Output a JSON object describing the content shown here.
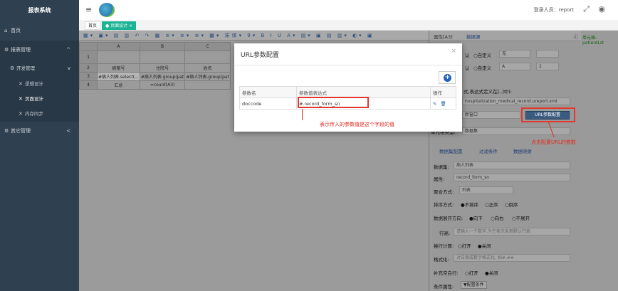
{
  "app": {
    "brand": "报表系统"
  },
  "sidebar": {
    "home": "首页",
    "report_mgmt": "报表管理",
    "dev_mgmt": "开发管理",
    "logic_design": "逻辑设计",
    "page_design": "页面设计",
    "memory_sync": "内存同步",
    "other_mgmt": "其它管理"
  },
  "header": {
    "login_user": "登录人员：report"
  },
  "tabs": {
    "home": "首页",
    "page_design": "● 页面设计 ×"
  },
  "toolbar": {
    "icons": "▦▾ ▣▾ ▤ ▥ ↶ ↷ ▦ ≡▾ ≡▾ ≡▾ ▦▾ 宋体▾ 9▾ B I U A▾ ▤▾ ▣ ▤ ▥▾ ◐▾ ▣"
  },
  "grid": {
    "columns": [
      "A",
      "B",
      "C"
    ],
    "rows": [
      {
        "num": "1",
        "cells": [
          "",
          "",
          ""
        ]
      },
      {
        "num": "2",
        "cells": [
          "病案号",
          "住院号",
          "姓名"
        ]
      },
      {
        "num": "3",
        "cells": [
          "#病人列表.select(...",
          "#病人列表.group(pat",
          "#病人列表.group(pat"
        ]
      },
      {
        "num": "4",
        "cells": [
          "汇总",
          "=count(A3)",
          ""
        ]
      }
    ]
  },
  "panel": {
    "tab_props": "属性[A3]",
    "tab_dataset": "数据源",
    "row1": [
      "认",
      "○自定义",
      "无"
    ],
    "row2": [
      "认",
      "○自定义",
      "A",
      "2"
    ],
    "expr_label": "式,表达式定义在[..]中):",
    "url_value": "hospitalization_medical_record.ureport.xml",
    "new_window": "新窗口",
    "url_btn": "URL参数配置",
    "cell_type_label": "单元格类型:",
    "cell_type_value": "数据集",
    "subtabs": [
      "数据集配置",
      "过滤条件",
      "数据映射"
    ],
    "dataset_label": "数据集:",
    "dataset_value": "病人列表",
    "attr_label": "属性:",
    "attr_value": "record_form_sn",
    "agg_label": "聚合方式:",
    "agg_value": "列表",
    "sort_label": "排序方式:",
    "sort_opts": [
      "●不排序",
      "○正序",
      "○倒序"
    ],
    "expand_label": "数据展开方向:",
    "expand_opts": [
      "●向下",
      "○向右",
      "○不展开"
    ],
    "rowh_label": "行高:",
    "rowh_placeholder": "请输入一个数字,为空表示采用默认行高",
    "linecalc_label": "换行计算:",
    "linecalc_opts": [
      "○打开",
      "●关闭"
    ],
    "format_label": "格式化:",
    "format_placeholder": "对日期或数字格式化, 如#.##",
    "fill_label": "补充空白行:",
    "fill_opts": [
      "○打开",
      "●关闭"
    ],
    "cond_label": "条件属性:",
    "cond_btn": "▼配置条件"
  },
  "far": {
    "label": "单元格: patientLst"
  },
  "modal": {
    "title": "URL参数配置",
    "close": "×",
    "col_name": "参数名",
    "col_expr": "参数值表达式",
    "col_op": "操作",
    "row_name": "doccode",
    "row_expr": "#.record_form_sn"
  },
  "annotations": {
    "expr_note": "表示传入的参数值是这个字段的值",
    "url_note": "点击配置URL的参数"
  },
  "colors": {
    "sidebar": "#2f4050",
    "accent": "#1ab394",
    "annotation": "#e02b20"
  }
}
